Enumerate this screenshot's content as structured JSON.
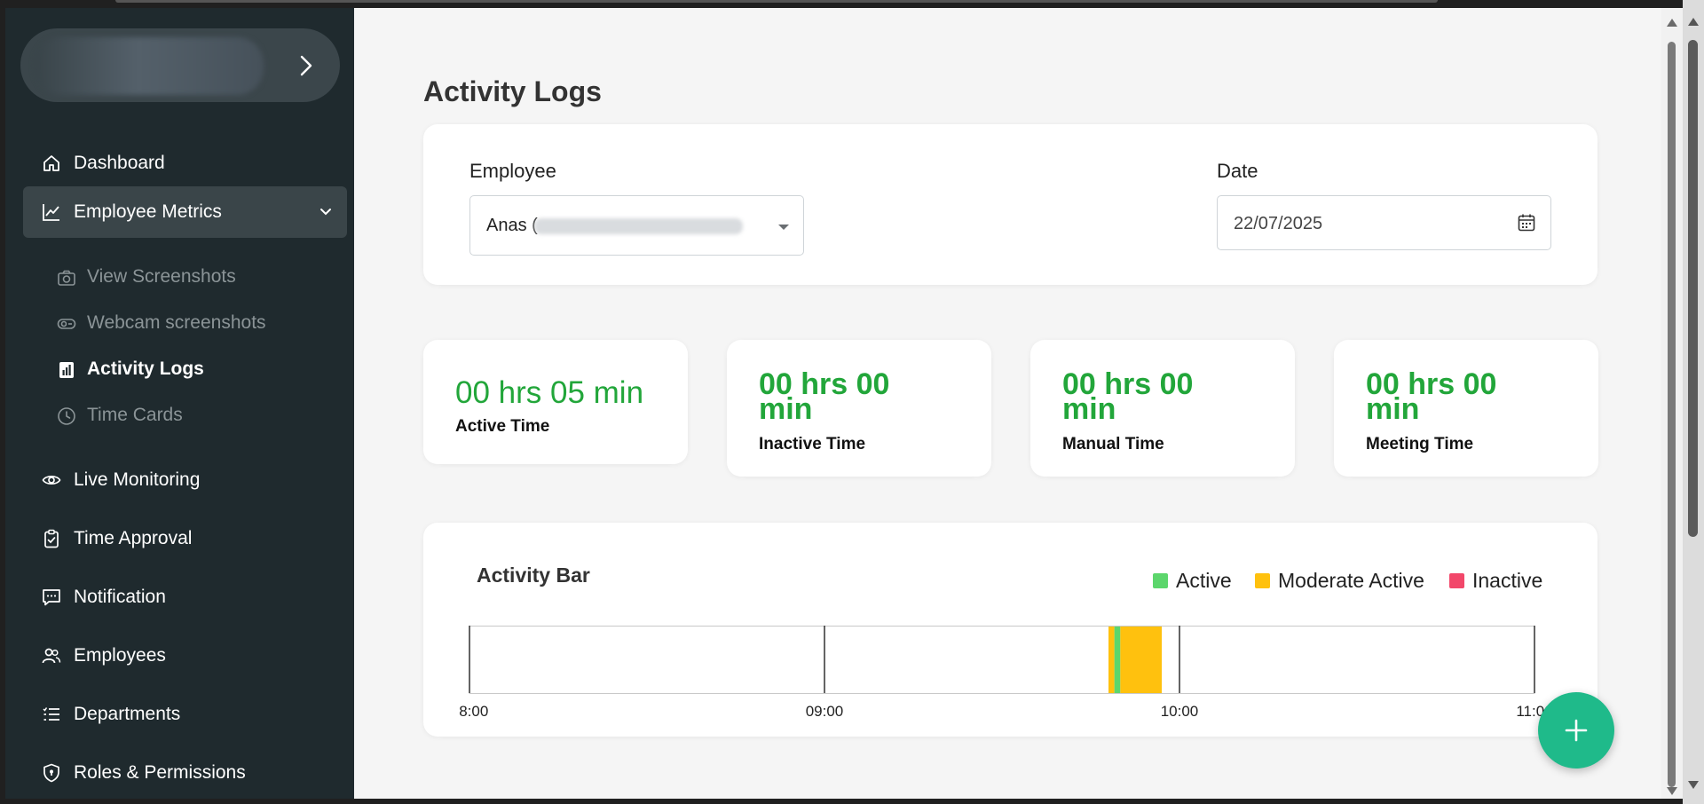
{
  "org": {
    "name": "Organization"
  },
  "sidebar": {
    "items": [
      {
        "label": "Dashboard",
        "icon": "home-icon"
      },
      {
        "label": "Employee Metrics",
        "icon": "chart-line-icon",
        "expanded": true,
        "children": [
          {
            "label": "View Screenshots",
            "icon": "camera-icon"
          },
          {
            "label": "Webcam screenshots",
            "icon": "webcam-icon"
          },
          {
            "label": "Activity Logs",
            "icon": "bar-chart-icon",
            "current": true
          },
          {
            "label": "Time Cards",
            "icon": "clock-icon"
          }
        ]
      },
      {
        "label": "Live Monitoring",
        "icon": "eye-icon"
      },
      {
        "label": "Time Approval",
        "icon": "clipboard-check-icon"
      },
      {
        "label": "Notification",
        "icon": "message-icon"
      },
      {
        "label": "Employees",
        "icon": "users-icon"
      },
      {
        "label": "Departments",
        "icon": "list-icon"
      },
      {
        "label": "Roles & Permissions",
        "icon": "shield-icon"
      }
    ]
  },
  "page": {
    "title": "Activity Logs"
  },
  "filters": {
    "employee_label": "Employee",
    "employee_value": "Anas (",
    "date_label": "Date",
    "date_value": "22/07/2025"
  },
  "stats": [
    {
      "value": "00 hrs 05 min",
      "label": "Active Time"
    },
    {
      "value": "00 hrs 00 min",
      "label": "Inactive Time"
    },
    {
      "value": "00 hrs 00 min",
      "label": "Manual Time"
    },
    {
      "value": "00 hrs 00 min",
      "label": "Meeting Time"
    }
  ],
  "activity": {
    "title": "Activity Bar",
    "legend": [
      {
        "label": "Active",
        "color": "#5cd66c"
      },
      {
        "label": "Moderate Active",
        "color": "#ffc10e"
      },
      {
        "label": "Inactive",
        "color": "#f2476a"
      }
    ]
  },
  "chart_data": {
    "type": "bar",
    "title": "Activity Bar",
    "x_ticks": [
      "08:00",
      "09:00",
      "10:00",
      "11:00"
    ],
    "x_range": [
      "08:00",
      "11:00"
    ],
    "segments": [
      {
        "start": "09:48",
        "end": "09:49",
        "level": "Moderate Active"
      },
      {
        "start": "09:49",
        "end": "09:50",
        "level": "Active"
      },
      {
        "start": "09:50",
        "end": "09:57",
        "level": "Moderate Active"
      }
    ],
    "colors": {
      "Active": "#5cd66c",
      "Moderate Active": "#ffc10e",
      "Inactive": "#f2476a"
    }
  },
  "colors": {
    "accent": "#22a63a",
    "fab": "#1fba8a",
    "sidebar": "#1f2a2e"
  }
}
